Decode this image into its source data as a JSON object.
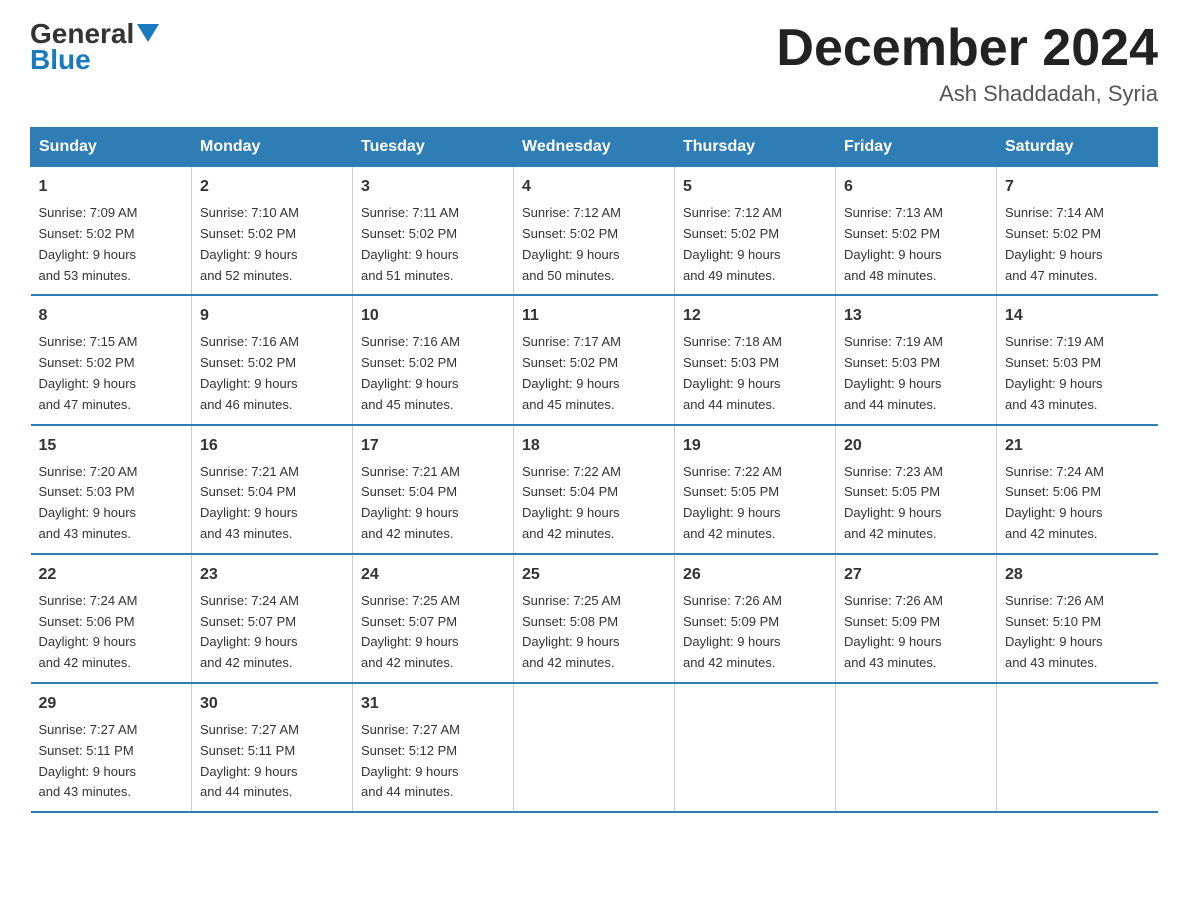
{
  "header": {
    "logo_line1": "General",
    "logo_line2": "Blue",
    "main_title": "December 2024",
    "subtitle": "Ash Shaddadah, Syria"
  },
  "days_of_week": [
    "Sunday",
    "Monday",
    "Tuesday",
    "Wednesday",
    "Thursday",
    "Friday",
    "Saturday"
  ],
  "weeks": [
    [
      {
        "day": "1",
        "sunrise": "7:09 AM",
        "sunset": "5:02 PM",
        "daylight": "9 hours and 53 minutes."
      },
      {
        "day": "2",
        "sunrise": "7:10 AM",
        "sunset": "5:02 PM",
        "daylight": "9 hours and 52 minutes."
      },
      {
        "day": "3",
        "sunrise": "7:11 AM",
        "sunset": "5:02 PM",
        "daylight": "9 hours and 51 minutes."
      },
      {
        "day": "4",
        "sunrise": "7:12 AM",
        "sunset": "5:02 PM",
        "daylight": "9 hours and 50 minutes."
      },
      {
        "day": "5",
        "sunrise": "7:12 AM",
        "sunset": "5:02 PM",
        "daylight": "9 hours and 49 minutes."
      },
      {
        "day": "6",
        "sunrise": "7:13 AM",
        "sunset": "5:02 PM",
        "daylight": "9 hours and 48 minutes."
      },
      {
        "day": "7",
        "sunrise": "7:14 AM",
        "sunset": "5:02 PM",
        "daylight": "9 hours and 47 minutes."
      }
    ],
    [
      {
        "day": "8",
        "sunrise": "7:15 AM",
        "sunset": "5:02 PM",
        "daylight": "9 hours and 47 minutes."
      },
      {
        "day": "9",
        "sunrise": "7:16 AM",
        "sunset": "5:02 PM",
        "daylight": "9 hours and 46 minutes."
      },
      {
        "day": "10",
        "sunrise": "7:16 AM",
        "sunset": "5:02 PM",
        "daylight": "9 hours and 45 minutes."
      },
      {
        "day": "11",
        "sunrise": "7:17 AM",
        "sunset": "5:02 PM",
        "daylight": "9 hours and 45 minutes."
      },
      {
        "day": "12",
        "sunrise": "7:18 AM",
        "sunset": "5:03 PM",
        "daylight": "9 hours and 44 minutes."
      },
      {
        "day": "13",
        "sunrise": "7:19 AM",
        "sunset": "5:03 PM",
        "daylight": "9 hours and 44 minutes."
      },
      {
        "day": "14",
        "sunrise": "7:19 AM",
        "sunset": "5:03 PM",
        "daylight": "9 hours and 43 minutes."
      }
    ],
    [
      {
        "day": "15",
        "sunrise": "7:20 AM",
        "sunset": "5:03 PM",
        "daylight": "9 hours and 43 minutes."
      },
      {
        "day": "16",
        "sunrise": "7:21 AM",
        "sunset": "5:04 PM",
        "daylight": "9 hours and 43 minutes."
      },
      {
        "day": "17",
        "sunrise": "7:21 AM",
        "sunset": "5:04 PM",
        "daylight": "9 hours and 42 minutes."
      },
      {
        "day": "18",
        "sunrise": "7:22 AM",
        "sunset": "5:04 PM",
        "daylight": "9 hours and 42 minutes."
      },
      {
        "day": "19",
        "sunrise": "7:22 AM",
        "sunset": "5:05 PM",
        "daylight": "9 hours and 42 minutes."
      },
      {
        "day": "20",
        "sunrise": "7:23 AM",
        "sunset": "5:05 PM",
        "daylight": "9 hours and 42 minutes."
      },
      {
        "day": "21",
        "sunrise": "7:24 AM",
        "sunset": "5:06 PM",
        "daylight": "9 hours and 42 minutes."
      }
    ],
    [
      {
        "day": "22",
        "sunrise": "7:24 AM",
        "sunset": "5:06 PM",
        "daylight": "9 hours and 42 minutes."
      },
      {
        "day": "23",
        "sunrise": "7:24 AM",
        "sunset": "5:07 PM",
        "daylight": "9 hours and 42 minutes."
      },
      {
        "day": "24",
        "sunrise": "7:25 AM",
        "sunset": "5:07 PM",
        "daylight": "9 hours and 42 minutes."
      },
      {
        "day": "25",
        "sunrise": "7:25 AM",
        "sunset": "5:08 PM",
        "daylight": "9 hours and 42 minutes."
      },
      {
        "day": "26",
        "sunrise": "7:26 AM",
        "sunset": "5:09 PM",
        "daylight": "9 hours and 42 minutes."
      },
      {
        "day": "27",
        "sunrise": "7:26 AM",
        "sunset": "5:09 PM",
        "daylight": "9 hours and 43 minutes."
      },
      {
        "day": "28",
        "sunrise": "7:26 AM",
        "sunset": "5:10 PM",
        "daylight": "9 hours and 43 minutes."
      }
    ],
    [
      {
        "day": "29",
        "sunrise": "7:27 AM",
        "sunset": "5:11 PM",
        "daylight": "9 hours and 43 minutes."
      },
      {
        "day": "30",
        "sunrise": "7:27 AM",
        "sunset": "5:11 PM",
        "daylight": "9 hours and 44 minutes."
      },
      {
        "day": "31",
        "sunrise": "7:27 AM",
        "sunset": "5:12 PM",
        "daylight": "9 hours and 44 minutes."
      },
      null,
      null,
      null,
      null
    ]
  ],
  "labels": {
    "sunrise": "Sunrise:",
    "sunset": "Sunset:",
    "daylight": "Daylight:"
  }
}
